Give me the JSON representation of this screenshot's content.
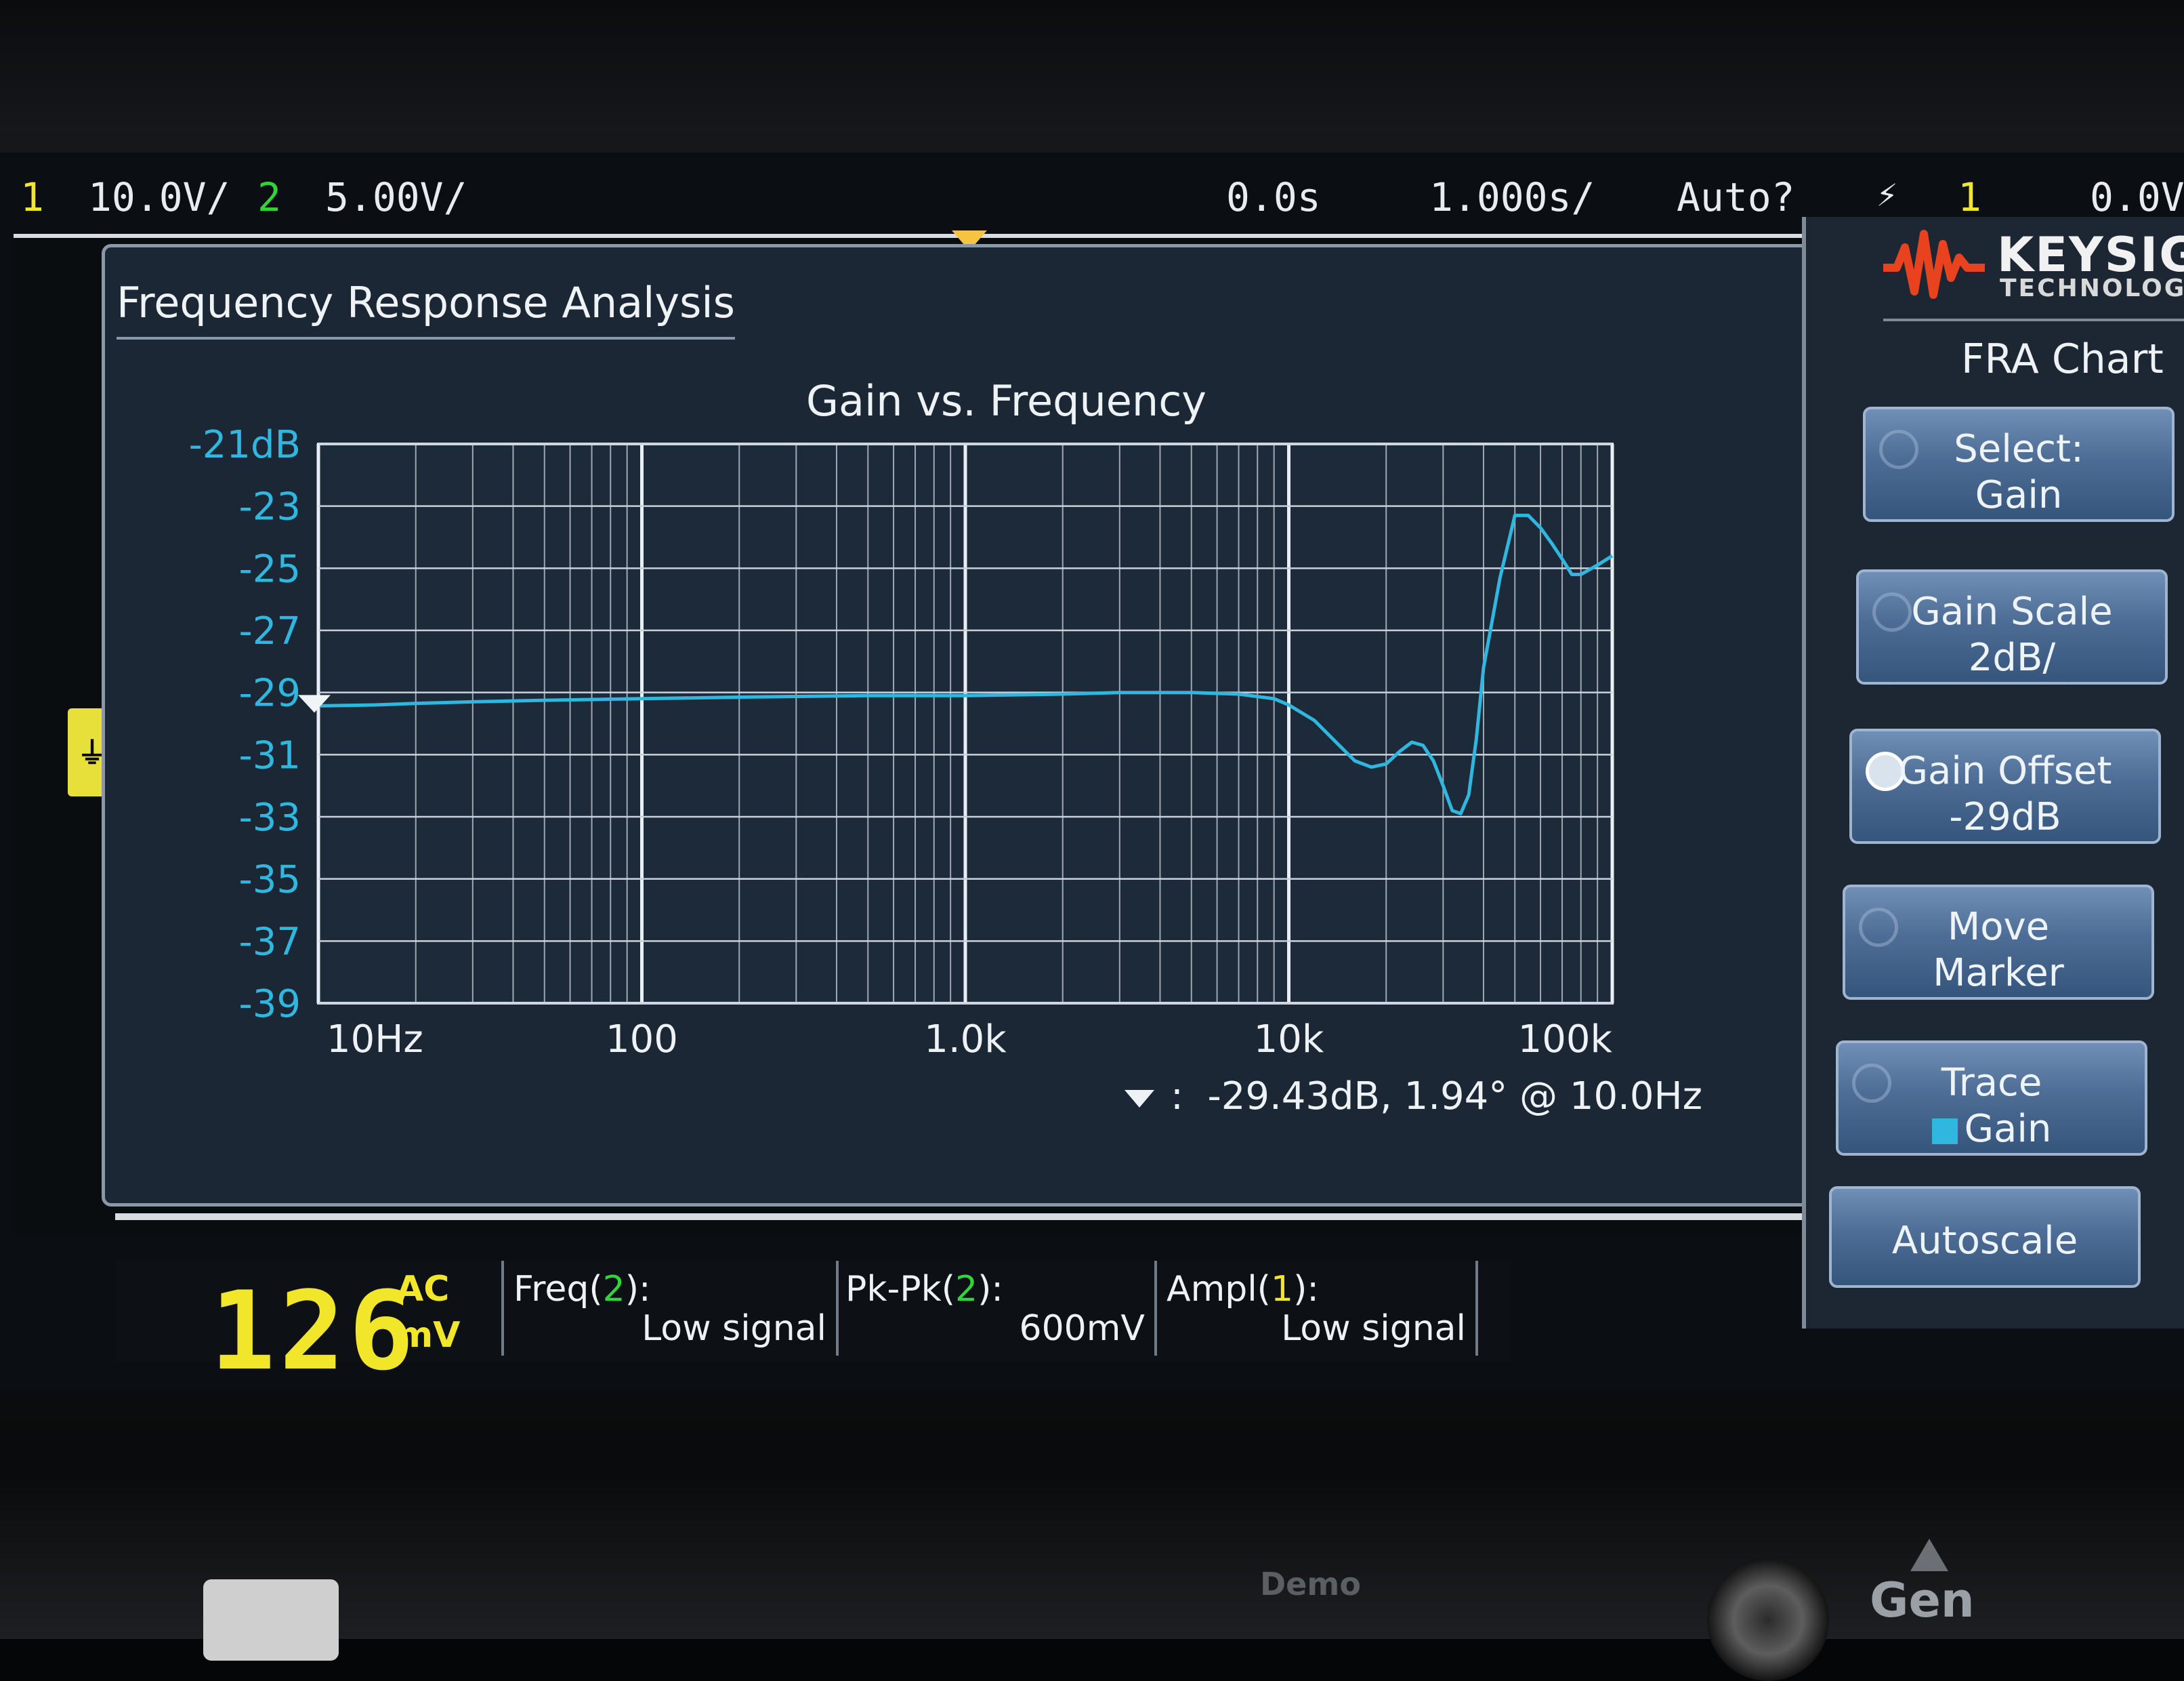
{
  "status_bar": {
    "ch1_num": "1",
    "ch1_scale": "10.0V/",
    "ch2_num": "2",
    "ch2_scale": "5.00V/",
    "time_offset": "0.0s",
    "time_scale": "1.000s/",
    "trigger_mode": "Auto?",
    "trigger_icon": "trigger-edge-icon",
    "trigger_channel": "1",
    "trigger_level": "0.0V"
  },
  "fra": {
    "window_title": "Frequency Response Analysis",
    "marker_symbol": ":",
    "marker_readout": "-29.43dB, 1.94° @ 10.0Hz"
  },
  "chart_data": {
    "type": "line",
    "title": "Gain vs. Frequency",
    "xscale": "log",
    "xlim": [
      10,
      100000
    ],
    "ylim": [
      -39,
      -21
    ],
    "y_ticks": [
      "-21dB",
      "-23",
      "-25",
      "-27",
      "-29",
      "-31",
      "-33",
      "-35",
      "-37",
      "-39"
    ],
    "y_tick_values": [
      -21,
      -23,
      -25,
      -27,
      -29,
      -31,
      -33,
      -35,
      -37,
      -39
    ],
    "x_ticks": [
      "10Hz",
      "100",
      "1.0k",
      "10k",
      "100k"
    ],
    "x_tick_values": [
      10,
      100,
      1000,
      10000,
      100000
    ],
    "grid": true,
    "line_color": "#2fb7e0",
    "series": [
      {
        "x": [
          10,
          15,
          20,
          30,
          50,
          100,
          200,
          500,
          1000,
          2000,
          3000,
          5000,
          7000,
          9000,
          10000,
          12000,
          14000,
          16000,
          18000,
          20000,
          22000,
          24000,
          26000,
          28000,
          30000,
          32000,
          34000,
          36000,
          38000,
          40000,
          45000,
          50000,
          55000,
          60000,
          65000,
          70000,
          75000,
          80000,
          90000,
          100000
        ],
        "y": [
          -29.43,
          -29.4,
          -29.35,
          -29.3,
          -29.25,
          -29.2,
          -29.15,
          -29.1,
          -29.1,
          -29.05,
          -29.0,
          -29.0,
          -29.05,
          -29.2,
          -29.4,
          -29.9,
          -30.6,
          -31.2,
          -31.4,
          -31.3,
          -30.9,
          -30.6,
          -30.7,
          -31.2,
          -32.0,
          -32.8,
          -32.9,
          -32.3,
          -30.5,
          -28.2,
          -25.3,
          -23.3,
          -23.3,
          -23.7,
          -24.2,
          -24.7,
          -25.2,
          -25.2,
          -24.9,
          -24.6
        ]
      }
    ]
  },
  "softkeys": {
    "brand": "KEYSIGHT",
    "brand_sub": "TECHNOLOGIES",
    "menu_title": "FRA Chart",
    "select": {
      "l1": "Select:",
      "l2": "Gain"
    },
    "gain_scale": {
      "l1": "Gain Scale",
      "l2": "2dB/"
    },
    "gain_offset": {
      "l1": "Gain Offset",
      "l2": "-29dB"
    },
    "move_marker": {
      "l1": "Move",
      "l2": "Marker"
    },
    "trace": {
      "l1": "Trace",
      "l2": "Gain"
    },
    "autoscale": {
      "l1": "Autoscale"
    }
  },
  "measurements": {
    "big_value": "126",
    "big_unit_top": "AC",
    "big_unit_bottom": "mV",
    "freq_label_pre": "Freq(",
    "freq_channel": "2",
    "freq_label_post": "):",
    "freq_value": "Low signal",
    "pkpk_label_pre": "Pk-Pk(",
    "pkpk_channel": "2",
    "pkpk_label_post": "):",
    "pkpk_value": "600mV",
    "ampl_label_pre": "Ampl(",
    "ampl_channel": "1",
    "ampl_label_post": "):",
    "ampl_value": "Low signal"
  },
  "hardware": {
    "demo_label": "Demo",
    "gen_label": "Gen"
  },
  "colors": {
    "ch1": "#f2e62a",
    "ch2": "#33d43a",
    "trace": "#2fb7e0",
    "softkey": "#4d6d96"
  }
}
